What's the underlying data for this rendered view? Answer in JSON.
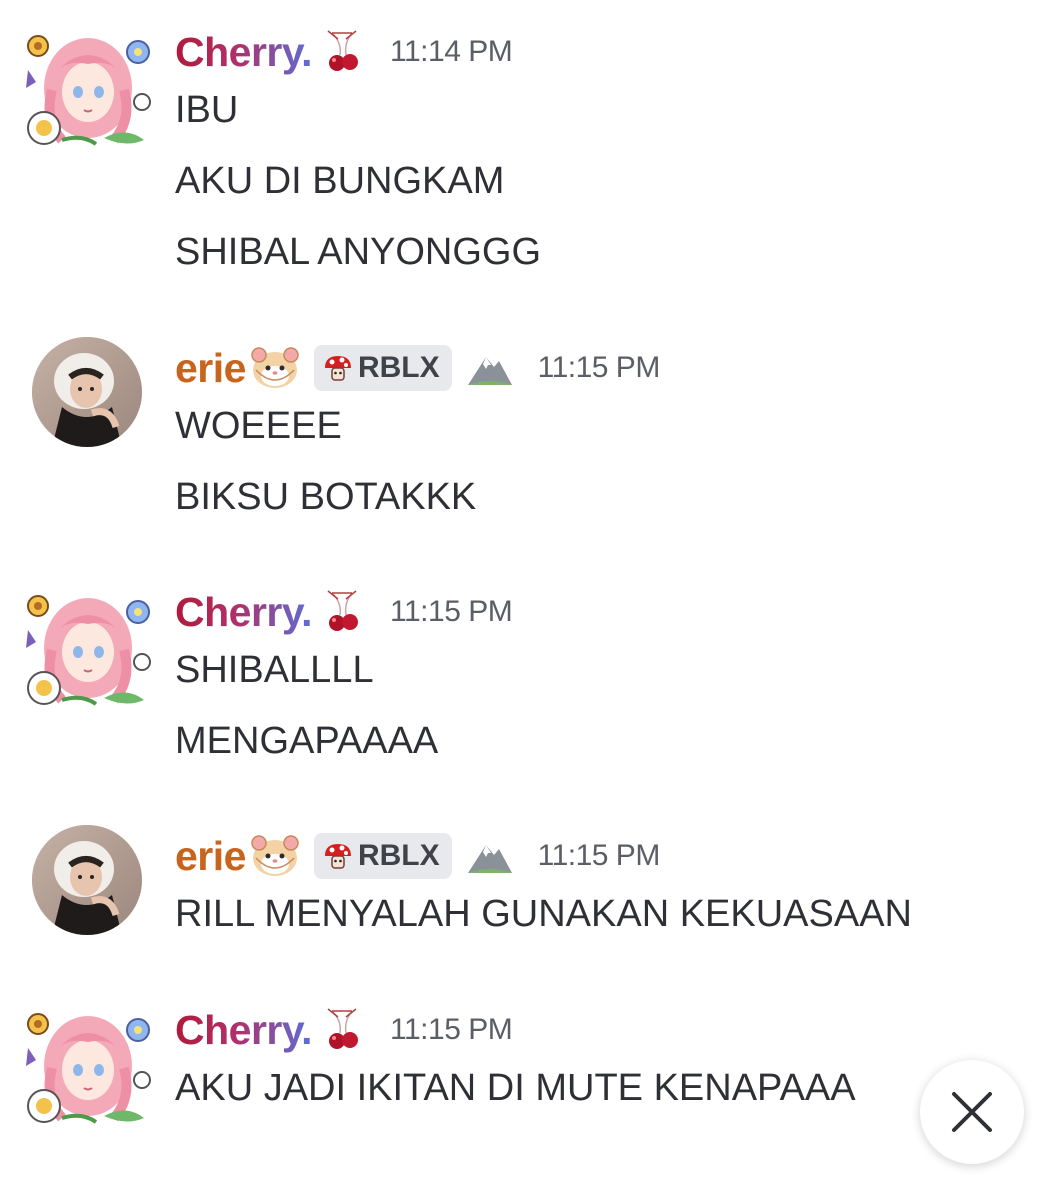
{
  "messages": [
    {
      "author": "Cherry.",
      "time": "11:14 PM",
      "lines": [
        "IBU",
        "AKU DI BUNGKAM",
        "SHIBAL ANYONGGG"
      ]
    },
    {
      "author": "erie",
      "tag": "RBLX",
      "time": "11:15 PM",
      "lines": [
        "WOEEEE",
        "BIKSU BOTAKKK"
      ]
    },
    {
      "author": "Cherry.",
      "time": "11:15 PM",
      "lines": [
        "SHIBALLLL",
        "MENGAPAAAA"
      ]
    },
    {
      "author": "erie",
      "tag": "RBLX",
      "time": "11:15 PM",
      "lines": [
        "RILL MENYALAH GUNAKAN KEKUASAAN"
      ]
    },
    {
      "author": "Cherry.",
      "time": "11:15 PM",
      "lines": [
        "AKU JADI IKITAN DI MUTE KENAPAAA"
      ]
    }
  ],
  "icons": {
    "cherry_decoration": "cherry-icon",
    "erie_decoration": "hamster-icon",
    "tag_icon": "mushroom-icon",
    "role_icon": "mountain-icon",
    "close": "close-icon"
  },
  "colors": {
    "cherry_name_start": "#b01a3a",
    "cherry_name_end": "#5a6fd8",
    "erie_name": "#c8641c",
    "text": "#2e3035",
    "timestamp": "#5c5e66",
    "tag_bg": "#e8e9ec"
  }
}
